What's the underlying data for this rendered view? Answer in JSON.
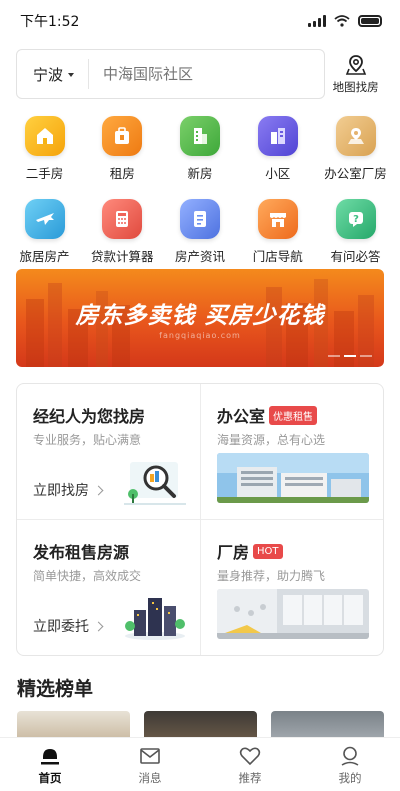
{
  "status_bar": {
    "time": "下午1:52"
  },
  "search": {
    "city": "宁波",
    "placeholder": "中海国际社区",
    "map_label": "地图找房"
  },
  "quick_menu": {
    "row1": [
      {
        "label": "二手房",
        "color": "#f5b314",
        "icon": "house-icon"
      },
      {
        "label": "租房",
        "color": "#f08a22",
        "icon": "suitcase-icon"
      },
      {
        "label": "新房",
        "color": "#55b84a",
        "icon": "building-icon"
      },
      {
        "label": "小区",
        "color": "#6a5be0",
        "icon": "apartment-icon"
      },
      {
        "label": "办公室厂房",
        "color": "#e4b36e",
        "icon": "map-pin-icon"
      }
    ],
    "row2": [
      {
        "label": "旅居房产",
        "color": "#3ab2e8",
        "icon": "airplane-icon"
      },
      {
        "label": "贷款计算器",
        "color": "#f0655a",
        "icon": "calculator-icon"
      },
      {
        "label": "房产资讯",
        "color": "#6a8ff0",
        "icon": "document-icon"
      },
      {
        "label": "门店导航",
        "color": "#f58a3a",
        "icon": "store-icon"
      },
      {
        "label": "有问必答",
        "color": "#3cbe82",
        "icon": "question-icon"
      }
    ]
  },
  "banner": {
    "title": "房东多卖钱 买房少花钱",
    "subtitle": "fangqiaqiao.com"
  },
  "cards": {
    "agent": {
      "title": "经纪人为您找房",
      "subtitle": "专业服务，贴心满意",
      "action": "立即找房"
    },
    "office": {
      "title": "办公室",
      "tag": "优惠租售",
      "subtitle": "海量资源，总有心选"
    },
    "publish": {
      "title": "发布租售房源",
      "subtitle": "简单快捷，高效成交",
      "action": "立即委托"
    },
    "factory": {
      "title": "厂房",
      "tag": "HOT",
      "subtitle": "量身推荐，助力腾飞"
    }
  },
  "featured": {
    "title": "精选榜单"
  },
  "tabbar": {
    "items": [
      {
        "label": "首页",
        "icon": "home-icon",
        "active": true
      },
      {
        "label": "消息",
        "icon": "mail-icon",
        "active": false
      },
      {
        "label": "推荐",
        "icon": "heart-icon",
        "active": false
      },
      {
        "label": "我的",
        "icon": "user-icon",
        "active": false
      }
    ]
  },
  "colors": {
    "accent": "#e8561c",
    "tag_red": "#e84a4a",
    "text_primary": "#222222",
    "text_secondary": "#999999"
  }
}
